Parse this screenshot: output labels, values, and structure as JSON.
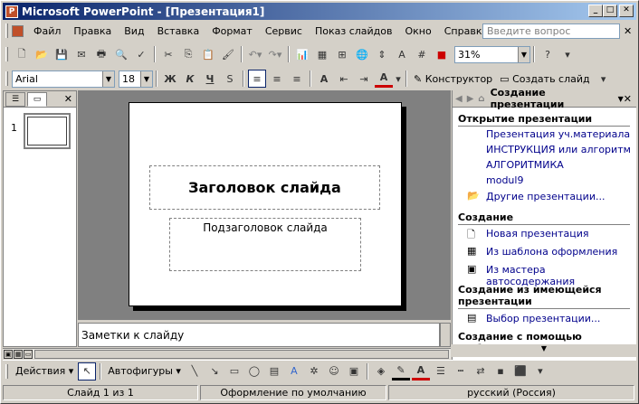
{
  "window": {
    "title": "Microsoft PowerPoint - [Презентация1]"
  },
  "menu": [
    "Файл",
    "Правка",
    "Вид",
    "Вставка",
    "Формат",
    "Сервис",
    "Показ слайдов",
    "Окно",
    "Справка"
  ],
  "help": {
    "placeholder": "Введите вопрос"
  },
  "toolbar": {
    "zoom": "31%"
  },
  "format": {
    "font": "Arial",
    "size": "18",
    "bold": "Ж",
    "italic": "К",
    "underline": "Ч",
    "designer": "Конструктор",
    "new_slide": "Создать слайд"
  },
  "slide": {
    "number": "1",
    "title": "Заголовок слайда",
    "subtitle": "Подзаголовок слайда"
  },
  "notes": {
    "text": "Заметки к слайду"
  },
  "taskpane": {
    "title": "Создание презентации",
    "open_section": "Открытие презентации",
    "recent": [
      "Презентация уч.материала",
      "ИНСТРУКЦИЯ или алгоритм",
      "АЛГОРИТМИКА",
      "modul9"
    ],
    "other": "Другие презентации...",
    "create_section": "Создание",
    "create_items": [
      "Новая презентация",
      "Из шаблона оформления",
      "Из мастера автосодержания"
    ],
    "existing_section": "Создание из имеющейся презентации",
    "choose": "Выбор презентации...",
    "template_section": "Создание с помощью шаблона"
  },
  "drawing": {
    "actions": "Действия",
    "autoshapes": "Автофигуры"
  },
  "status": {
    "slide": "Слайд 1 из 1",
    "design": "Оформление по умолчанию",
    "lang": "русский (Россия)"
  },
  "colors": {
    "title_start": "#0a246a",
    "title_end": "#a6caf0",
    "link": "#00008b"
  }
}
